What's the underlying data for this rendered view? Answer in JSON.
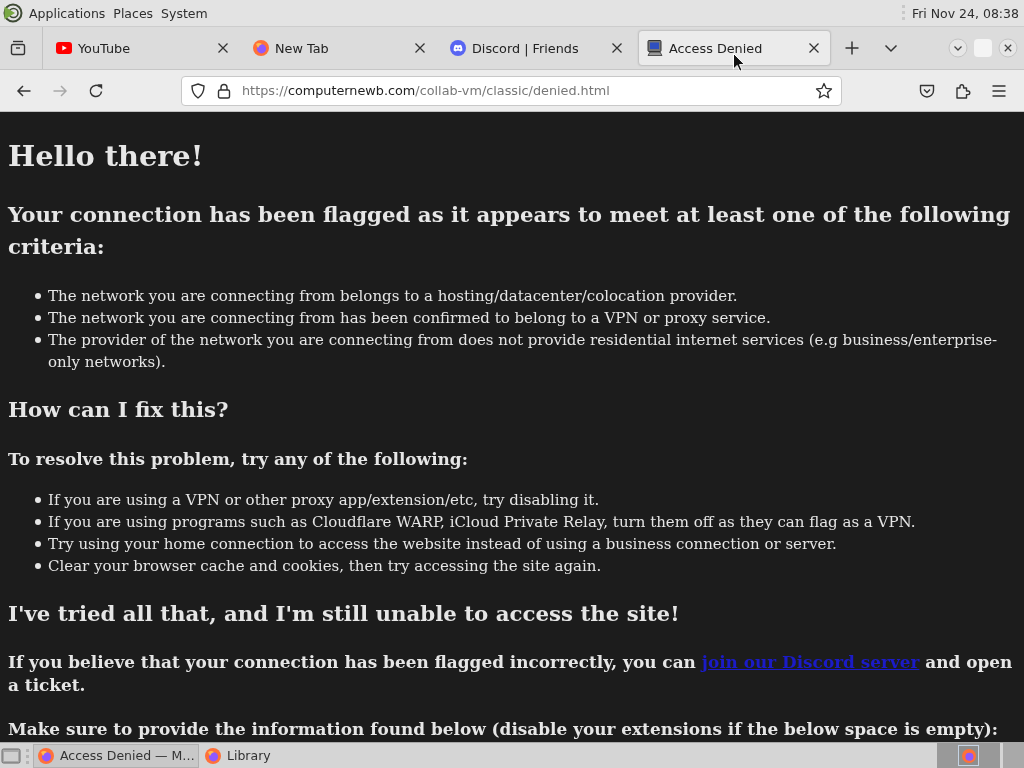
{
  "top_panel": {
    "menus": [
      "Applications",
      "Places",
      "System"
    ],
    "clock": "Fri Nov 24, 08:38"
  },
  "tabs": [
    {
      "title": "YouTube",
      "kind": "video",
      "selected": false
    },
    {
      "title": "New Tab",
      "kind": "browser",
      "selected": false
    },
    {
      "title": "Discord | Friends",
      "kind": "chat",
      "selected": false
    },
    {
      "title": "Access Denied",
      "kind": "computer",
      "selected": true
    }
  ],
  "nav_buttons": [
    {
      "kind": "back",
      "disabled": false
    },
    {
      "kind": "forward",
      "disabled": true
    },
    {
      "kind": "reload",
      "disabled": false
    }
  ],
  "url": {
    "scheme": "https://",
    "host": "computernewb.com",
    "path": "/collab-vm/classic/denied.html"
  },
  "page": {
    "blocks": [
      {
        "kind": "heading1",
        "text": "Hello there!"
      },
      {
        "kind": "heading2",
        "text": "Your connection has been flagged as it appears to meet at least one of the following criteria:"
      },
      {
        "kind": "list",
        "items": [
          "The network you are connecting from belongs to a hosting/datacenter/colocation provider.",
          "The network you are connecting from has been confirmed to belong to a VPN or proxy service.",
          "The provider of the network you are connecting from does not provide residential internet services (e.g business/enterprise-only networks)."
        ]
      },
      {
        "kind": "heading2",
        "text": "How can I fix this?"
      },
      {
        "kind": "heading3",
        "text": "To resolve this problem, try any of the following:"
      },
      {
        "kind": "list",
        "items": [
          "If you are using a VPN or other proxy app/extension/etc, try disabling it.",
          "If you are using programs such as Cloudflare WARP, iCloud Private Relay, turn them off as they can flag as a VPN.",
          "Try using your home connection to access the website instead of using a business connection or server.",
          "Clear your browser cache and cookies, then try accessing the site again."
        ]
      },
      {
        "kind": "heading2",
        "text": "I've tried all that, and I'm still unable to access the site!"
      },
      {
        "kind": "paragraph",
        "text": "If you believe that your connection has been flagged incorrectly, you can",
        "link": "join our Discord server",
        "text_after": "and open a ticket."
      },
      {
        "kind": "paragraph",
        "text": "Make sure to provide the information found below (disable your extensions if the below space is empty):"
      }
    ]
  },
  "taskbar": {
    "tasks": [
      {
        "title": "Access Denied — M…",
        "selected": true
      },
      {
        "title": "Library",
        "selected": false
      }
    ],
    "workspaces": [
      {
        "selected": true,
        "has_window": true
      },
      {
        "selected": false,
        "has_window": false
      }
    ]
  }
}
